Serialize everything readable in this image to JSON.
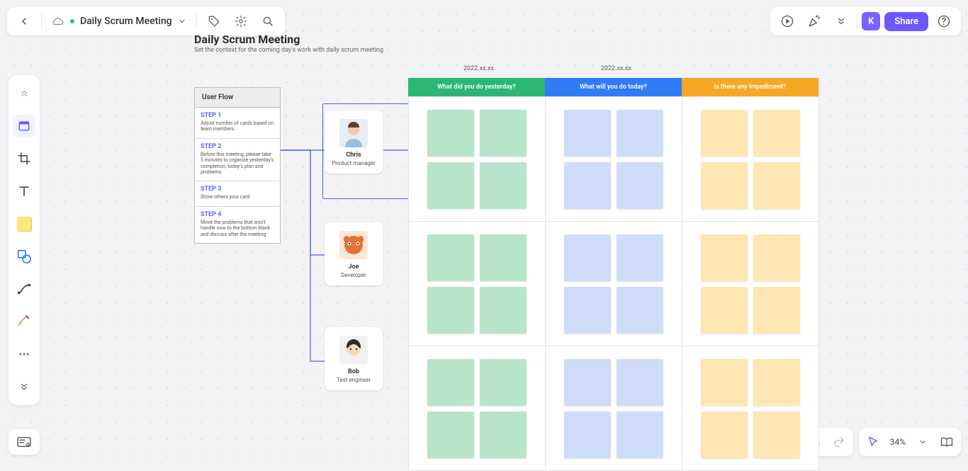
{
  "doc": {
    "title": "Daily Scrum Meeting",
    "avatar_initial": "K",
    "share_label": "Share"
  },
  "board": {
    "heading": "Daily Scrum Meeting",
    "subheading": "Set the context for the coming day's work with daily scrum meeting"
  },
  "userflow": {
    "header": "User Flow",
    "steps": [
      {
        "title": "STEP 1",
        "desc": "Adjust number of cards based on team members"
      },
      {
        "title": "STEP 2",
        "desc": "Before this meeting, please take 5 minutes to organize yesterday's completion, today's plan and problems"
      },
      {
        "title": "STEP 3",
        "desc": "Show others your card"
      },
      {
        "title": "STEP 4",
        "desc": "Move the problems that won't handle now to the bottom blank and discuss after the meeting"
      }
    ]
  },
  "people": [
    {
      "name": "Chris",
      "role": "Product manager"
    },
    {
      "name": "Joe",
      "role": "Developer"
    },
    {
      "name": "Bob",
      "role": "Test engineer"
    }
  ],
  "dates": [
    "2022.xx.xx",
    "2022.xx.xx"
  ],
  "columns": [
    {
      "label": "What did you do yesterday?"
    },
    {
      "label": "What will you do today?"
    },
    {
      "label": "Is there any impediment?"
    }
  ],
  "zoom": "34%"
}
